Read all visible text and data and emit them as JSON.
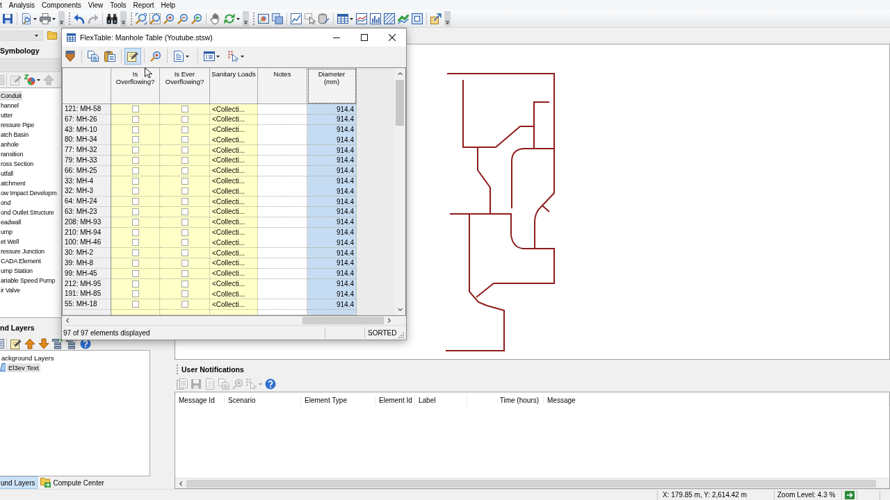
{
  "menu_bar": [
    "t",
    "Analysis",
    "Components",
    "View",
    "Tools",
    "Report",
    "Help"
  ],
  "toolbar": [
    [
      {
        "kind": "save",
        "disabled": false,
        "dropdown": false
      }
    ],
    [
      {
        "kind": "preview",
        "disabled": false,
        "dropdown": true
      },
      {
        "kind": "printer",
        "disabled": false,
        "dropdown": true
      },
      {
        "kind": "overflow",
        "disabled": false,
        "dropdown": false
      }
    ],
    [
      {
        "kind": "undo",
        "disabled": false,
        "dropdown": false
      },
      {
        "kind": "redo",
        "disabled": true,
        "dropdown": false
      }
    ],
    [
      {
        "kind": "binoculars",
        "disabled": false,
        "dropdown": false
      },
      {
        "kind": "overflow",
        "disabled": false,
        "dropdown": false
      }
    ],
    [
      {
        "kind": "zoom_extents",
        "disabled": false,
        "dropdown": false
      },
      {
        "kind": "zoom_window",
        "disabled": false,
        "dropdown": false
      },
      {
        "kind": "zoom_in",
        "disabled": false,
        "dropdown": false
      },
      {
        "kind": "zoom_out",
        "disabled": false,
        "dropdown": false
      },
      {
        "kind": "zoom_previous",
        "disabled": false,
        "dropdown": false
      }
    ],
    [
      {
        "kind": "pan",
        "disabled": false,
        "dropdown": false
      },
      {
        "kind": "refresh",
        "disabled": false,
        "dropdown": true
      },
      {
        "kind": "overflow",
        "disabled": false,
        "dropdown": false
      }
    ],
    [
      {
        "kind": "map",
        "disabled": false,
        "dropdown": false
      },
      {
        "kind": "layers",
        "disabled": false,
        "dropdown": false
      }
    ],
    [
      {
        "kind": "chart",
        "disabled": false,
        "dropdown": false
      },
      {
        "kind": "select",
        "disabled": false,
        "dropdown": false
      },
      {
        "kind": "properties",
        "disabled": false,
        "dropdown": false
      }
    ],
    [
      {
        "kind": "table",
        "disabled": false,
        "dropdown": true
      },
      {
        "kind": "profile",
        "disabled": false,
        "dropdown": false
      },
      {
        "kind": "graph",
        "disabled": false,
        "dropdown": false
      },
      {
        "kind": "hatch",
        "disabled": false,
        "dropdown": false
      },
      {
        "kind": "pipe",
        "disabled": false,
        "dropdown": false
      },
      {
        "kind": "frame",
        "disabled": false,
        "dropdown": false
      }
    ],
    [
      {
        "kind": "export",
        "disabled": false,
        "dropdown": false
      },
      {
        "kind": "overflow",
        "disabled": false,
        "dropdown": false
      }
    ]
  ],
  "left_panel": {
    "symbology": {
      "title": "Symbology",
      "toolbar": [
        [
          {
            "kind": "sliver",
            "disabled": true,
            "dropdown": false
          }
        ],
        [
          {
            "kind": "edit",
            "disabled": true,
            "dropdown": false
          },
          {
            "kind": "colors",
            "disabled": false,
            "dropdown": true
          },
          {
            "kind": "up",
            "disabled": true,
            "dropdown": false
          }
        ]
      ],
      "items": [
        {
          "label": "Conduit",
          "selected": true
        },
        {
          "label": "hannel",
          "selected": false
        },
        {
          "label": "utter",
          "selected": false
        },
        {
          "label": "ressure Pipe",
          "selected": false
        },
        {
          "label": "atch Basin",
          "selected": false
        },
        {
          "label": "anhole",
          "selected": false
        },
        {
          "label": "ransition",
          "selected": false
        },
        {
          "label": "ross Section",
          "selected": false
        },
        {
          "label": "utfall",
          "selected": false
        },
        {
          "label": "atchment",
          "selected": false
        },
        {
          "label": "ow Impact Developm",
          "selected": false
        },
        {
          "label": "ond",
          "selected": false
        },
        {
          "label": "ond Outlet Structure",
          "selected": false
        },
        {
          "label": "eadwall",
          "selected": false
        },
        {
          "label": "ump",
          "selected": false
        },
        {
          "label": "et Well",
          "selected": false
        },
        {
          "label": "ressure Junction",
          "selected": false
        },
        {
          "label": "CADA Element",
          "selected": false
        },
        {
          "label": "ump Station",
          "selected": false
        },
        {
          "label": "ariable Speed Pump",
          "selected": false
        },
        {
          "label": "ir Valve",
          "selected": false
        }
      ]
    },
    "background_layers": {
      "title": "nd Layers",
      "toolbar": [
        [
          {
            "kind": "sliver",
            "disabled": false,
            "dropdown": false
          }
        ],
        [
          {
            "kind": "edit",
            "disabled": false,
            "dropdown": false
          },
          {
            "kind": "up",
            "disabled": false,
            "dropdown": false
          },
          {
            "kind": "down",
            "disabled": false,
            "dropdown": false
          },
          {
            "kind": "tree_add",
            "disabled": false,
            "dropdown": false
          },
          {
            "kind": "tree_remove",
            "disabled": false,
            "dropdown": false
          },
          {
            "kind": "help",
            "disabled": false,
            "dropdown": false
          }
        ]
      ],
      "tree": [
        {
          "label": "ackground Layers",
          "selected": false,
          "children": [
            {
              "label": "El3ev Text",
              "selected": true
            }
          ]
        }
      ]
    },
    "tabs": [
      {
        "label": "und Layers",
        "selected": true,
        "has_icon": false
      },
      {
        "label": "Compute Center",
        "selected": false,
        "has_icon": true
      }
    ]
  },
  "flextable": {
    "title": "FlexTable: Manhole Table (Youtube.stsw)",
    "toolbar": [
      [
        {
          "kind": "marker",
          "pressed": false,
          "dropdown": false
        }
      ],
      [
        {
          "kind": "copy",
          "pressed": false,
          "dropdown": false
        },
        {
          "kind": "paste",
          "pressed": false,
          "dropdown": false
        }
      ],
      [
        {
          "kind": "edit",
          "pressed": true,
          "dropdown": false
        }
      ],
      [
        {
          "kind": "zoom_in",
          "pressed": false,
          "dropdown": false
        }
      ],
      [
        {
          "kind": "report",
          "pressed": false,
          "dropdown": true
        }
      ],
      [
        {
          "kind": "options",
          "pressed": false,
          "dropdown": true
        },
        {
          "kind": "grid_select",
          "pressed": false,
          "dropdown": true
        }
      ]
    ],
    "columns": [
      {
        "label": "Is Overflowing?",
        "kind": "checkbox",
        "read_only": true,
        "selected": false
      },
      {
        "label": "Is Ever Overflowing?",
        "kind": "checkbox",
        "read_only": true,
        "selected": false
      },
      {
        "label": "Sanitary Loads",
        "kind": "text",
        "read_only": true,
        "selected": false
      },
      {
        "label": "Notes",
        "kind": "text",
        "read_only": false,
        "selected": false
      },
      {
        "label": "Diameter (mm)",
        "kind": "number",
        "read_only": false,
        "selected": true
      }
    ],
    "rows": [
      {
        "label": "121: MH-58",
        "cells": [
          {
            "checked": false
          },
          {
            "checked": false
          },
          {
            "text": "<Collecti..."
          },
          {},
          {
            "text": "914.4"
          }
        ]
      },
      {
        "label": "67: MH-26",
        "cells": [
          {
            "checked": false
          },
          {
            "checked": false
          },
          {
            "text": "<Collecti..."
          },
          {},
          {
            "text": "914.4"
          }
        ]
      },
      {
        "label": "43: MH-10",
        "cells": [
          {
            "checked": false
          },
          {
            "checked": false
          },
          {
            "text": "<Collecti..."
          },
          {},
          {
            "text": "914.4"
          }
        ]
      },
      {
        "label": "80: MH-34",
        "cells": [
          {
            "checked": false
          },
          {
            "checked": false
          },
          {
            "text": "<Collecti..."
          },
          {},
          {
            "text": "914.4"
          }
        ]
      },
      {
        "label": "77: MH-32",
        "cells": [
          {
            "checked": false
          },
          {
            "checked": false
          },
          {
            "text": "<Collecti..."
          },
          {},
          {
            "text": "914.4"
          }
        ]
      },
      {
        "label": "79: MH-33",
        "cells": [
          {
            "checked": false
          },
          {
            "checked": false
          },
          {
            "text": "<Collecti..."
          },
          {},
          {
            "text": "914.4"
          }
        ]
      },
      {
        "label": "66: MH-25",
        "cells": [
          {
            "checked": false
          },
          {
            "checked": false
          },
          {
            "text": "<Collecti..."
          },
          {},
          {
            "text": "914.4"
          }
        ]
      },
      {
        "label": "33: MH-4",
        "cells": [
          {
            "checked": false
          },
          {
            "checked": false
          },
          {
            "text": "<Collecti..."
          },
          {},
          {
            "text": "914.4"
          }
        ]
      },
      {
        "label": "32: MH-3",
        "cells": [
          {
            "checked": false
          },
          {
            "checked": false
          },
          {
            "text": "<Collecti..."
          },
          {},
          {
            "text": "914.4"
          }
        ]
      },
      {
        "label": "64: MH-24",
        "cells": [
          {
            "checked": false
          },
          {
            "checked": false
          },
          {
            "text": "<Collecti..."
          },
          {},
          {
            "text": "914.4"
          }
        ]
      },
      {
        "label": "63: MH-23",
        "cells": [
          {
            "checked": false
          },
          {
            "checked": false
          },
          {
            "text": "<Collecti..."
          },
          {},
          {
            "text": "914.4"
          }
        ]
      },
      {
        "label": "208: MH-93",
        "cells": [
          {
            "checked": false
          },
          {
            "checked": false
          },
          {
            "text": "<Collecti..."
          },
          {},
          {
            "text": "914.4"
          }
        ]
      },
      {
        "label": "210: MH-94",
        "cells": [
          {
            "checked": false
          },
          {
            "checked": false
          },
          {
            "text": "<Collecti..."
          },
          {},
          {
            "text": "914.4"
          }
        ]
      },
      {
        "label": "100: MH-46",
        "cells": [
          {
            "checked": false
          },
          {
            "checked": false
          },
          {
            "text": "<Collecti..."
          },
          {},
          {
            "text": "914.4"
          }
        ]
      },
      {
        "label": "30: MH-2",
        "cells": [
          {
            "checked": false
          },
          {
            "checked": false
          },
          {
            "text": "<Collecti..."
          },
          {},
          {
            "text": "914.4"
          }
        ]
      },
      {
        "label": "39: MH-8",
        "cells": [
          {
            "checked": false
          },
          {
            "checked": false
          },
          {
            "text": "<Collecti..."
          },
          {},
          {
            "text": "914.4"
          }
        ]
      },
      {
        "label": "99: MH-45",
        "cells": [
          {
            "checked": false
          },
          {
            "checked": false
          },
          {
            "text": "<Collecti..."
          },
          {},
          {
            "text": "914.4"
          }
        ]
      },
      {
        "label": "212: MH-95",
        "cells": [
          {
            "checked": false
          },
          {
            "checked": false
          },
          {
            "text": "<Collecti..."
          },
          {},
          {
            "text": "914.4"
          }
        ]
      },
      {
        "label": "191: MH-85",
        "cells": [
          {
            "checked": false
          },
          {
            "checked": false
          },
          {
            "text": "<Collecti..."
          },
          {},
          {
            "text": "914.4"
          }
        ]
      },
      {
        "label": "55: MH-18",
        "cells": [
          {
            "checked": false
          },
          {
            "checked": false
          },
          {
            "text": "<Collecti..."
          },
          {},
          {
            "text": "914.4"
          }
        ]
      }
    ],
    "status": "97 of 97 elements displayed",
    "sort_state": "SORTED"
  },
  "notifications": {
    "title": "User Notifications",
    "toolbar": [
      {
        "kind": "copy_report",
        "disabled": true,
        "dropdown": false
      },
      {
        "kind": "save",
        "disabled": true,
        "dropdown": false
      },
      {
        "kind": "page",
        "disabled": true,
        "dropdown": false
      },
      {
        "kind": "copy",
        "disabled": true,
        "dropdown": false
      },
      {
        "kind": "zoom_in",
        "disabled": true,
        "dropdown": false
      },
      {
        "kind": "grid_select",
        "disabled": true,
        "dropdown": true
      },
      {
        "kind": "help",
        "disabled": false,
        "dropdown": false
      }
    ],
    "columns": [
      {
        "label": "Message Id",
        "kind": "text"
      },
      {
        "label": "Scenario",
        "kind": "text"
      },
      {
        "label": "Element Type",
        "kind": "text"
      },
      {
        "label": "Element Id",
        "kind": "text"
      },
      {
        "label": "Label",
        "kind": "text"
      },
      {
        "label": "Time (hours)",
        "kind": "number"
      },
      {
        "label": "Message",
        "kind": "text"
      }
    ]
  },
  "status_bar": {
    "coordinates": "X: 179.85 m, Y: 2,614.42 m",
    "zoom_level": "Zoom Level: 4.3 %"
  }
}
